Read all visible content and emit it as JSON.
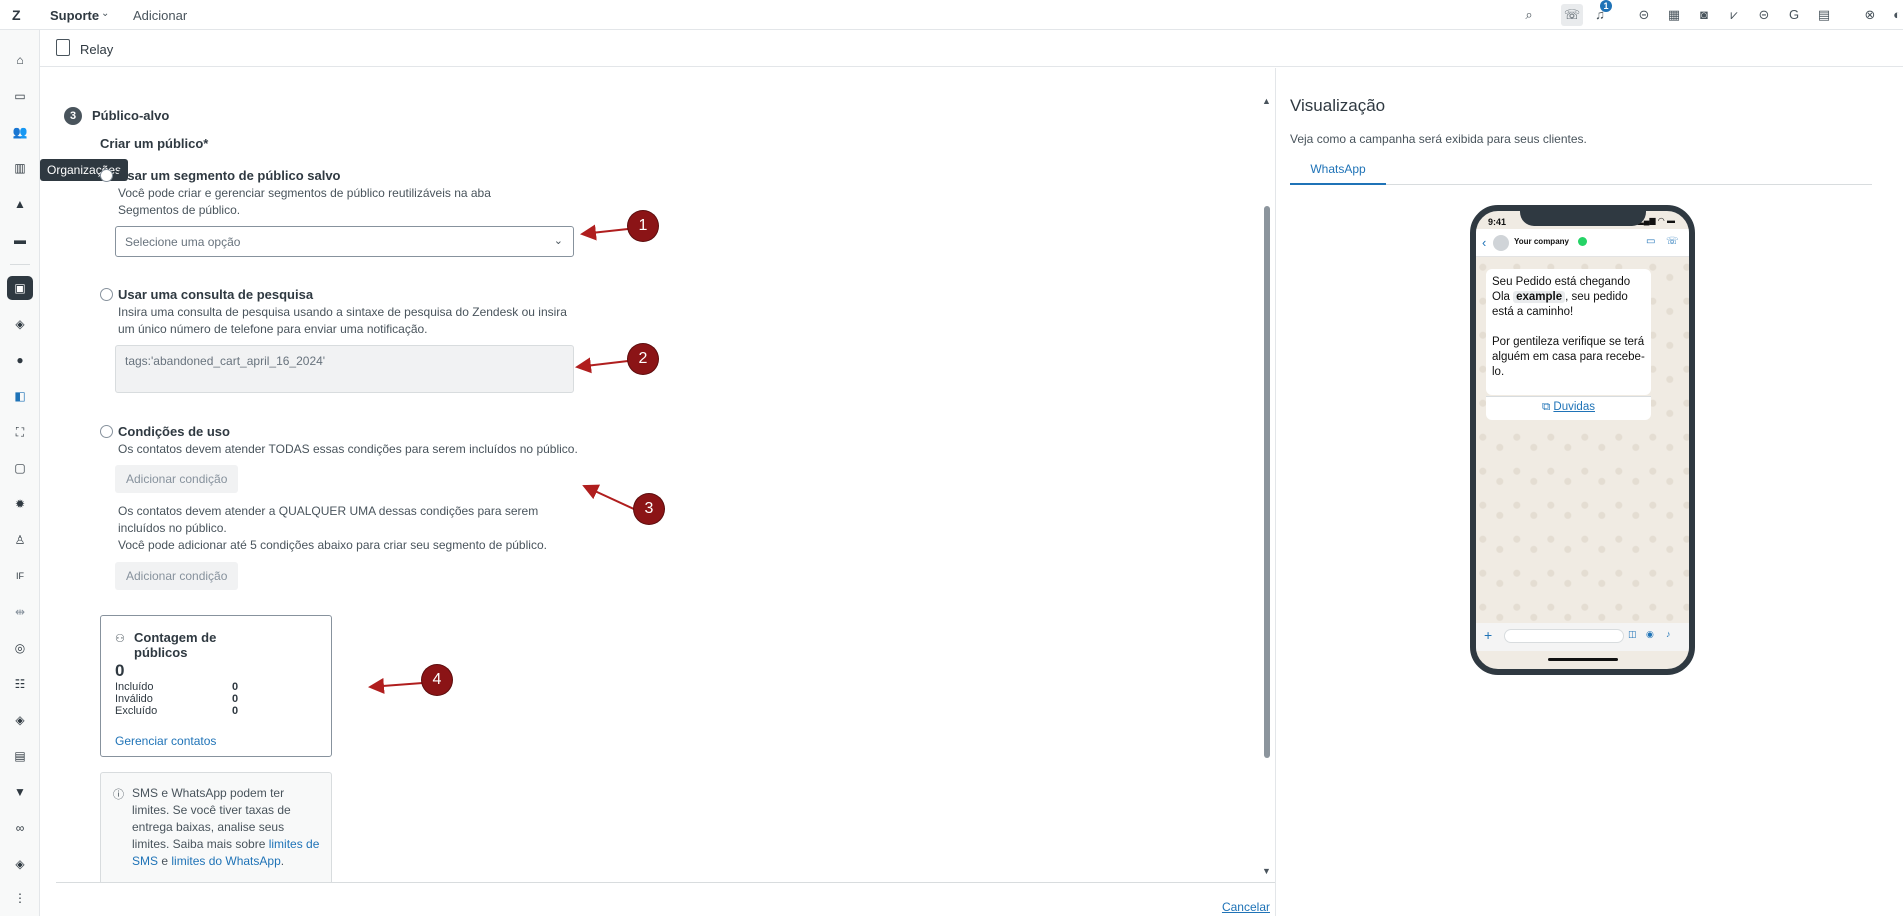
{
  "topbar": {
    "product": "Suporte",
    "add_label": "Adicionar",
    "notification_count": "1"
  },
  "rail": {
    "tooltip": "Organizações",
    "more_icon": "⋮"
  },
  "header": {
    "app_name": "Relay"
  },
  "form": {
    "step_number": "3",
    "step_title": "Público-alvo",
    "create_label": "Criar um público*",
    "option1": {
      "title": "Usar um segmento de público salvo",
      "hint": "Você pode criar e gerenciar segmentos de público reutilizáveis na aba Segmentos de público.",
      "select_placeholder": "Selecione uma opção"
    },
    "option2": {
      "title": "Usar uma consulta de pesquisa",
      "hint": "Insira uma consulta de pesquisa usando a sintaxe de pesquisa do Zendesk ou insira um único número de telefone para enviar uma notificação.",
      "query_value": "tags:'abandoned_cart_april_16_2024'"
    },
    "option3": {
      "title": "Condições de uso",
      "hint_all": "Os contatos devem atender TODAS essas condições para serem incluídos no público.",
      "add_condition_label": "Adicionar condição",
      "hint_any": "Os contatos devem atender a QUALQUER UMA dessas condições para serem incluídos no público.",
      "hint_limit": "Você pode adicionar até 5 condições abaixo para criar seu segmento de público.",
      "add_condition_label_2": "Adicionar condição"
    },
    "audience_count": {
      "title": "Contagem de públicos",
      "total": "0",
      "rows": [
        {
          "label": "Incluído",
          "value": "0"
        },
        {
          "label": "Inválido",
          "value": "0"
        },
        {
          "label": "Excluído",
          "value": "0"
        }
      ],
      "manage_link": "Gerenciar contatos"
    },
    "info": {
      "text_before": "SMS e WhatsApp podem ter limites. Se você tiver taxas de entrega baixas, analise seus limites. Saiba mais sobre ",
      "link_sms": "limites de SMS",
      "text_and": " e ",
      "link_whatsapp": "limites do WhatsApp",
      "text_end": "."
    },
    "markers": [
      "1",
      "2",
      "3",
      "4"
    ]
  },
  "footer": {
    "cancel_label": "Cancelar"
  },
  "preview": {
    "title": "Visualização",
    "subtitle": "Veja como a campanha será exibida para seus clientes.",
    "tab": "WhatsApp",
    "phone": {
      "time": "9:41",
      "status": "▂▄▆ ◠ ▬",
      "company": "Your company",
      "message_line1": "Seu Pedido está chegando",
      "message_ola": "Ola",
      "message_var": "example",
      "message_rest": ", seu pedido está a caminho!",
      "message_line3": "Por gentileza verifique se terá alguém em casa para recebe-lo.",
      "button_label": "Duvidas"
    }
  },
  "colors": {
    "accent": "#1f73b7",
    "marker": "#8b1416",
    "text": "#2f3941"
  }
}
